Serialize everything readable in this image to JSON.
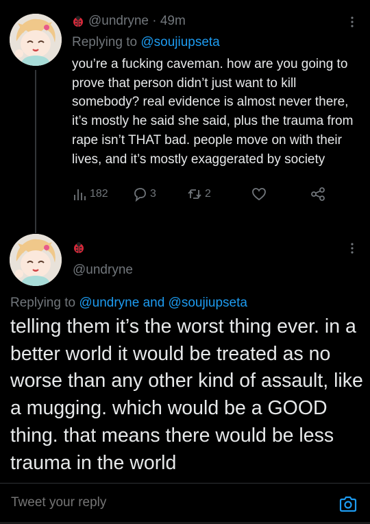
{
  "tweet1": {
    "handle": "@undryne · 49m",
    "replying_prefix": "Replying to ",
    "replying_to": "@soujiupseta",
    "body": "you’re a fucking caveman. how are you going to prove that person didn’t just want to kill somebody? real evidence is almost never there, it’s mostly he said she said, plus the trauma from rape isn’t THAT bad. people move on with their lives, and it’s mostly exaggerated by society",
    "views": "182",
    "replies": "3",
    "retweets": "2"
  },
  "tweet2": {
    "handle": "@undryne",
    "replying_prefix": "Replying to ",
    "replying_to": "@undryne and @soujiupseta",
    "body": "telling them it’s the worst thing ever. in a better world it would be treated as no worse than any other kind of assault, like a mugging. which would be a GOOD thing. that means there would be less trauma in the world"
  },
  "composer": {
    "placeholder": "Tweet your reply"
  },
  "icons": {
    "more": "more-vertical-icon",
    "views": "views-icon",
    "reply": "reply-icon",
    "retweet": "retweet-icon",
    "like": "like-icon",
    "share": "share-icon",
    "camera": "camera-icon",
    "emoji": "ladybug-emoji"
  },
  "colors": {
    "background": "#000000",
    "text": "#e7e9ea",
    "muted": "#71767b",
    "link": "#1d9bf0"
  }
}
